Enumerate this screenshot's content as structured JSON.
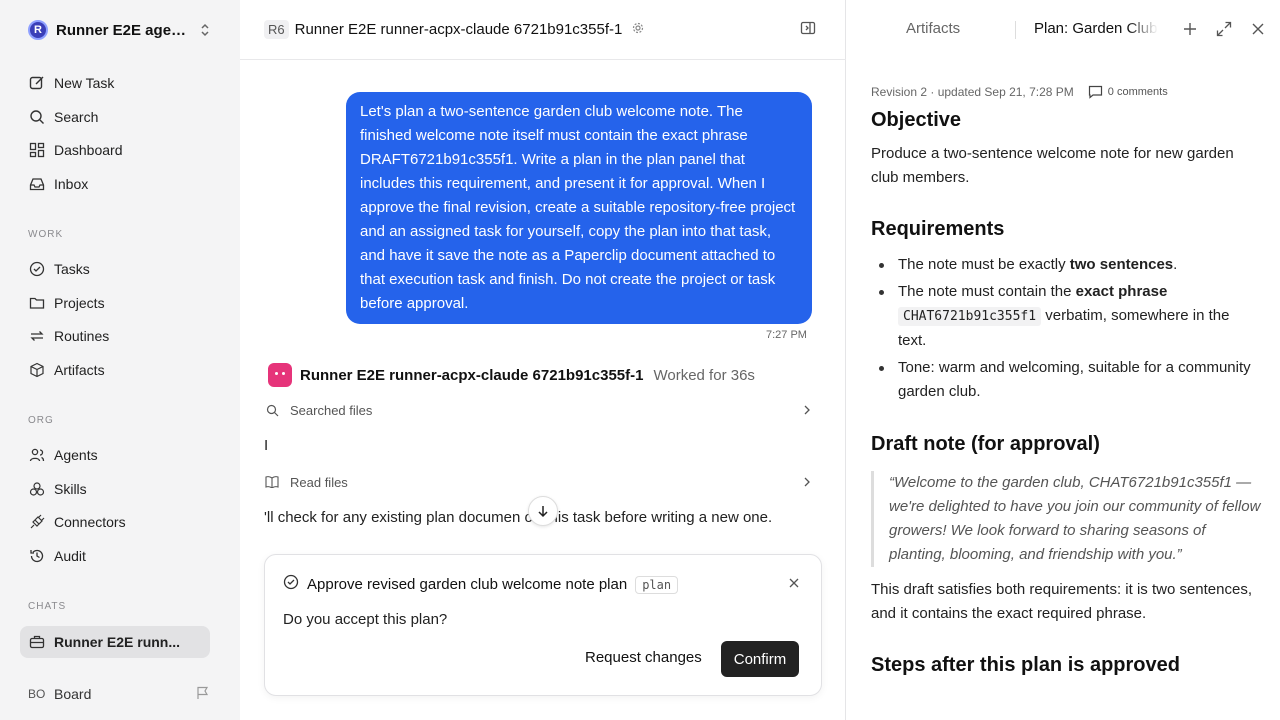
{
  "sidebar": {
    "workspace": {
      "initial": "R",
      "name": "Runner E2E agen..."
    },
    "top_items": [
      {
        "label": "New Task"
      },
      {
        "label": "Search"
      },
      {
        "label": "Dashboard"
      },
      {
        "label": "Inbox"
      }
    ],
    "work_label": "WORK",
    "work_items": [
      {
        "label": "Tasks"
      },
      {
        "label": "Projects"
      },
      {
        "label": "Routines"
      },
      {
        "label": "Artifacts"
      }
    ],
    "org_label": "ORG",
    "org_items": [
      {
        "label": "Agents"
      },
      {
        "label": "Skills"
      },
      {
        "label": "Connectors"
      },
      {
        "label": "Audit"
      }
    ],
    "chats_label": "CHATS",
    "chat_items": [
      {
        "label": "Runner E2E runn..."
      }
    ],
    "board": {
      "initials": "BO",
      "label": "Board"
    }
  },
  "chat": {
    "header": {
      "badge": "R6",
      "title": "Runner E2E runner-acpx-claude 6721b91c355f-1"
    },
    "user_message": "Let's plan a two-sentence garden club welcome note. The finished welcome note itself must contain the exact phrase DRAFT6721b91c355f1. Write a plan in the plan panel that includes this requirement, and present it for approval. When I approve the final revision, create a suitable repository-free project and an assigned task for yourself, copy the plan into that task, and have it save the note as a Paperclip document attached to that execution task and finish. Do not create the project or task before approval.",
    "user_message_time": "7:27 PM",
    "agent": {
      "name": "Runner E2E runner-acpx-claude 6721b91c355f-1",
      "worked": "Worked for 36s"
    },
    "tool_searched": "Searched files",
    "stream_1": "I",
    "tool_read": "Read files",
    "stream_2": "'ll check for any existing plan documen on this task before writing a new one.",
    "approval": {
      "title": "Approve revised garden club welcome note plan",
      "tag": "plan",
      "question": "Do you accept this plan?",
      "request_label": "Request changes",
      "confirm_label": "Confirm"
    }
  },
  "panel": {
    "tab_artifacts": "Artifacts",
    "tab_plan": "Plan: Garden Club",
    "meta": "Revision 2 · updated Sep 21, 7:28 PM",
    "comments": "0 comments",
    "objective_heading": "Objective",
    "objective_text": "Produce a two-sentence welcome note for new garden club members.",
    "requirements_heading": "Requirements",
    "req1_pre": "The note must be exactly ",
    "req1_bold": "two sentences",
    "req1_post": ".",
    "req2_pre": "The note must contain the ",
    "req2_bold": "exact phrase",
    "req2_code": "CHAT6721b91c355f1",
    "req2_post": " verbatim, somewhere in the text.",
    "req3": "Tone: warm and welcoming, suitable for a community garden club.",
    "draft_heading": "Draft note (for approval)",
    "draft_quote": "“Welcome to the garden club, CHAT6721b91c355f1 — we're delighted to have you join our community of fellow growers! We look forward to sharing seasons of planting, blooming, and friendship with you.”",
    "draft_summary": "This draft satisfies both requirements: it is two sentences, and it contains the exact required phrase.",
    "steps_heading": "Steps after this plan is approved"
  },
  "colors": {
    "accent": "#2563eb",
    "agent_avatar": "#e6347a",
    "confirm_bg": "#222222"
  }
}
